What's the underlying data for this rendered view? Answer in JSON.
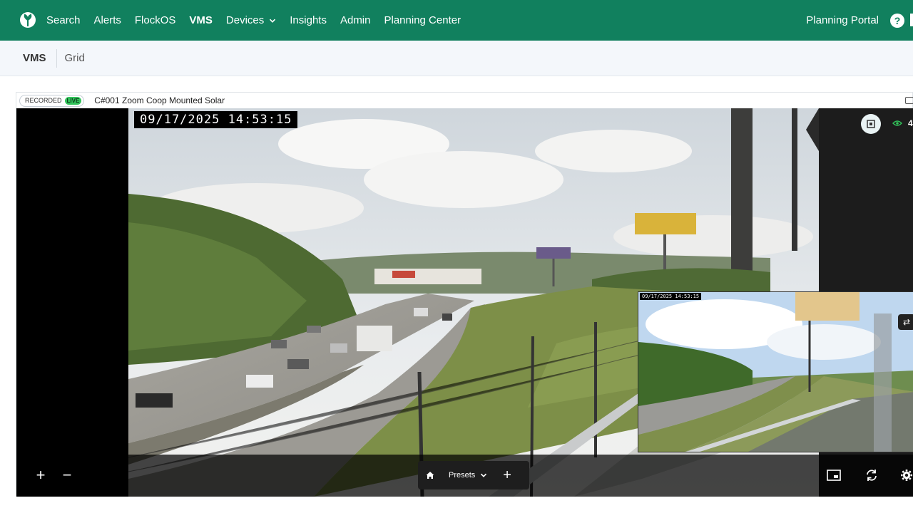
{
  "nav": {
    "items": [
      {
        "label": "Search"
      },
      {
        "label": "Alerts"
      },
      {
        "label": "FlockOS"
      },
      {
        "label": "VMS"
      },
      {
        "label": "Devices"
      },
      {
        "label": "Insights"
      },
      {
        "label": "Admin"
      },
      {
        "label": "Planning Center"
      }
    ],
    "right_link": "Planning Portal",
    "help_glyph": "?"
  },
  "subnav": {
    "title": "VMS",
    "tab": "Grid"
  },
  "camera": {
    "recorded_label": "RECORDED",
    "live_label": "LIVE",
    "name": "C#001 Zoom Coop Mounted Solar",
    "timestamp": "09/17/2025 14:53:15",
    "pip_timestamp": "09/17/2025 14:53:15",
    "viewer_count": "4"
  },
  "controls": {
    "zoom_in": "+",
    "zoom_out": "−",
    "presets_label": "Presets",
    "add_preset": "+",
    "swap_glyph": "⇄"
  },
  "icons": [
    "flock-logo-icon",
    "chevron-down-icon",
    "help-icon",
    "home-icon",
    "eye-icon",
    "snapshot-icon",
    "pip-icon",
    "refresh-icon",
    "gear-icon"
  ],
  "colors": {
    "brand": "#11805e",
    "live": "#32c25a",
    "subnav_bg": "#f4f7fb"
  }
}
